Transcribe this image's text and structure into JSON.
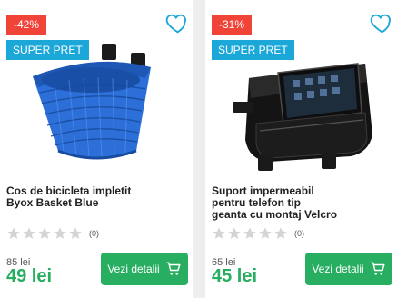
{
  "products": [
    {
      "discount": "-42%",
      "badge": "SUPER PRET",
      "title_lines": [
        "Cos de bicicleta impletit",
        "Byox Basket Blue"
      ],
      "rating_count": "(0)",
      "old_price": "85 lei",
      "new_price": "49 lei",
      "cta_label": "Vezi detalii"
    },
    {
      "discount": "-31%",
      "badge": "SUPER PRET",
      "title_lines": [
        "Suport impermeabil",
        "pentru telefon tip",
        "geanta cu montaj Velcro"
      ],
      "rating_count": "(0)",
      "old_price": "65 lei",
      "new_price": "45 lei",
      "cta_label": "Vezi detalii"
    }
  ],
  "colors": {
    "discount": "#f04438",
    "badge": "#1ba7d8",
    "price": "#27ae60",
    "cta": "#27ae60",
    "heart": "#1ba7d8",
    "star": "#d4d4d4"
  },
  "icons": [
    "heart-icon",
    "star-icon",
    "cart-icon"
  ]
}
